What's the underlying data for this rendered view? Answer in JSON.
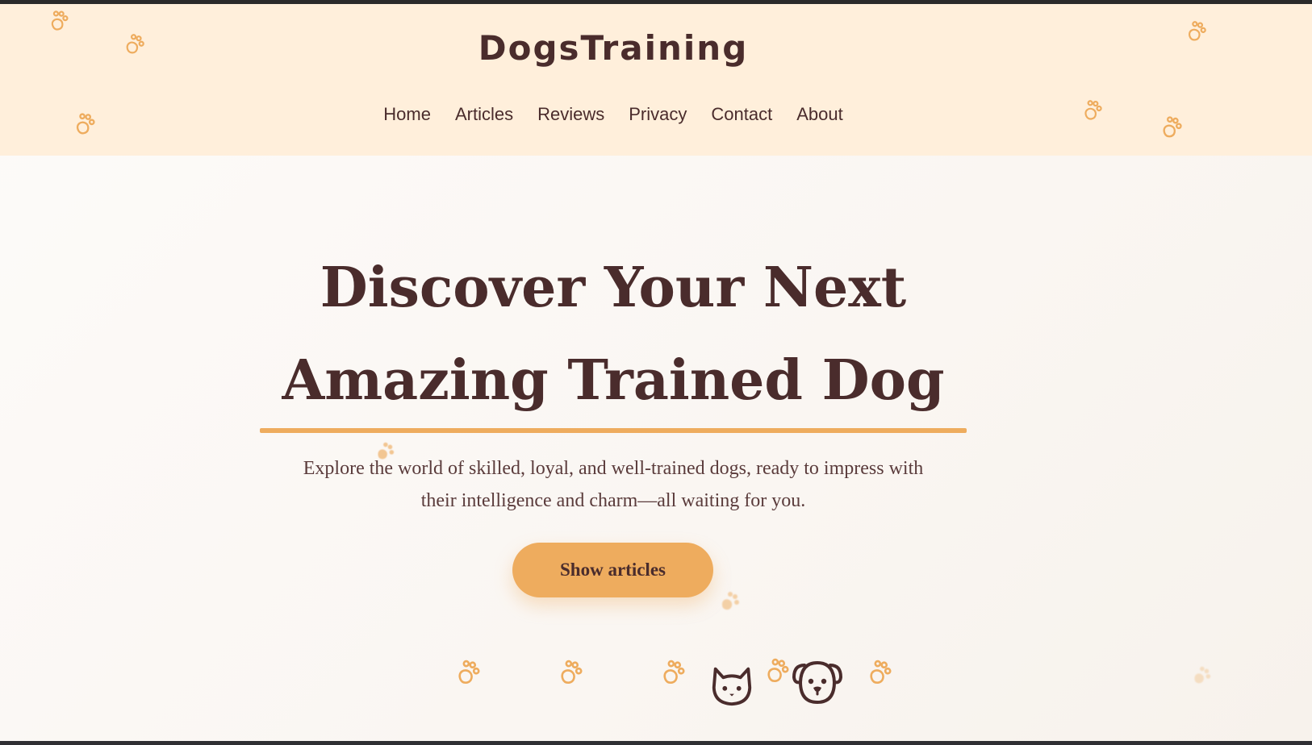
{
  "header": {
    "brand": "DogsTraining",
    "nav": [
      "Home",
      "Articles",
      "Reviews",
      "Privacy",
      "Contact",
      "About"
    ]
  },
  "hero": {
    "title_line1": "Discover Your Next",
    "title_line2": "Amazing Trained Dog",
    "subtitle_line1": "Explore the world of skilled, loyal, and well-trained dogs, ready to impress with",
    "subtitle_line2": "their intelligence and charm—all waiting for you.",
    "cta_label": "Show articles"
  },
  "icons": {
    "decorative": "paw-print",
    "pets": [
      "cat-face",
      "dog-face"
    ]
  },
  "colors": {
    "header_bg": "#ffefdb",
    "accent": "#eeac5e",
    "text": "#4a2c2c"
  }
}
